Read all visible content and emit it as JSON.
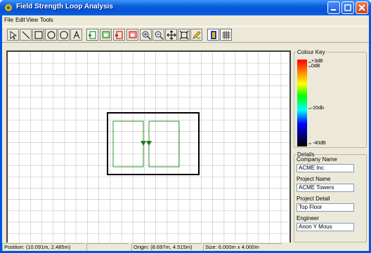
{
  "window": {
    "title": "Field Strength Loop Analysis"
  },
  "menu": {
    "items": [
      "File",
      "Edit",
      "View",
      "Tools"
    ]
  },
  "toolbar": {
    "tools": [
      "select-arrow-icon",
      "line-icon",
      "rectangle-icon",
      "circle-icon",
      "rounded-square-icon",
      "text-icon",
      "loop-icon",
      "loop-green-icon",
      "loop-red-icon",
      "loop-red-filled-icon",
      "zoom-in-icon",
      "zoom-out-icon",
      "pan-icon",
      "fit-icon",
      "pencil-icon",
      "colour-key-icon",
      "grid-icon"
    ],
    "pressed": [
      "loop-icon",
      "colour-key-icon",
      "grid-icon"
    ]
  },
  "colour_key": {
    "title": "Colour Key",
    "labels": [
      "+3dB",
      "0dB",
      "-20db",
      "-40dB"
    ]
  },
  "details": {
    "title": "Details",
    "fields": [
      {
        "label": "Company Name",
        "value": "ACME Inc"
      },
      {
        "label": "Project Name",
        "value": "ACME Towers"
      },
      {
        "label": "Project Detail",
        "value": "Top Floor"
      },
      {
        "label": "Engineer",
        "value": "Anon Y Mous"
      }
    ]
  },
  "status": {
    "position": "Position: (10.091m, 2.485m)",
    "origin": "Origin: (8.697m, 4.515m)",
    "size": "Size: 6.000m x 4.000m"
  },
  "colors": {
    "loop": "#2e9a2e",
    "grid": "#c8c8c8",
    "titlebar": "#0453d6"
  }
}
